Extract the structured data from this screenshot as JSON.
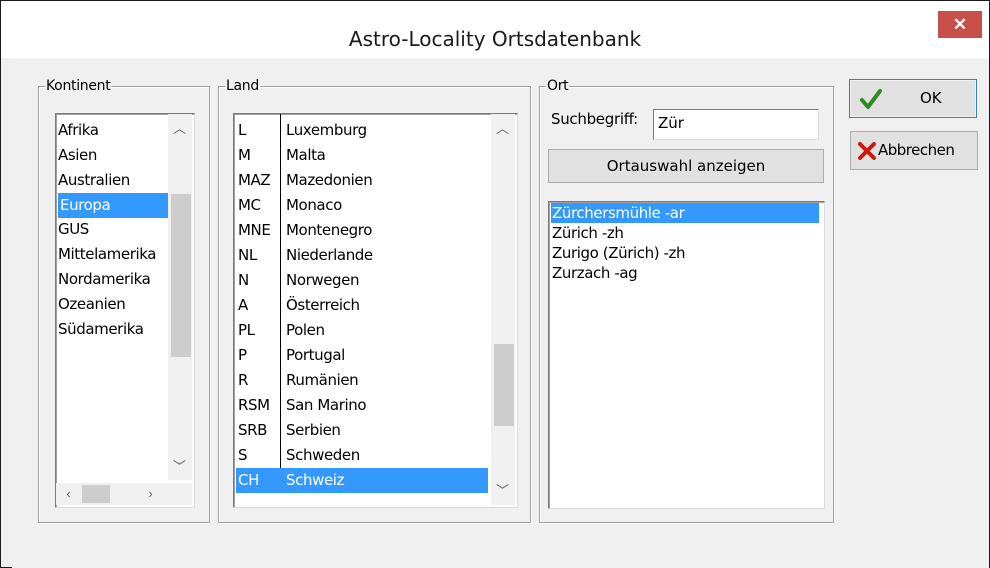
{
  "window": {
    "title": "Astro-Locality Ortsdatenbank",
    "close_glyph": "✕"
  },
  "kontinent": {
    "label": "Kontinent",
    "items": [
      "Afrika",
      "Asien",
      "Australien",
      "Europa",
      "GUS",
      "Mittelamerika",
      "Nordamerika",
      "Ozeanien",
      "Südamerika"
    ],
    "selected": "Europa"
  },
  "land": {
    "label": "Land",
    "items": [
      {
        "code": "L",
        "name": "Luxemburg"
      },
      {
        "code": "M",
        "name": "Malta"
      },
      {
        "code": "MAZ",
        "name": "Mazedonien"
      },
      {
        "code": "MC",
        "name": "Monaco"
      },
      {
        "code": "MNE",
        "name": "Montenegro"
      },
      {
        "code": "NL",
        "name": "Niederlande"
      },
      {
        "code": "N",
        "name": "Norwegen"
      },
      {
        "code": "A",
        "name": "Österreich"
      },
      {
        "code": "PL",
        "name": "Polen"
      },
      {
        "code": "P",
        "name": "Portugal"
      },
      {
        "code": "R",
        "name": "Rumänien"
      },
      {
        "code": "RSM",
        "name": "San Marino"
      },
      {
        "code": "SRB",
        "name": "Serbien"
      },
      {
        "code": "S",
        "name": "Schweden"
      },
      {
        "code": "CH",
        "name": "Schweiz"
      }
    ],
    "selected": "Schweiz"
  },
  "ort": {
    "label": "Ort",
    "search_label": "Suchbegriff:",
    "search_value": "Zür",
    "show_button": "Ortauswahl anzeigen",
    "results": [
      "Zürchersmühle -ar",
      "Zürich -zh",
      "Zurigo (Zürich) -zh",
      "Zurzach -ag"
    ],
    "selected": "Zürchersmühle -ar"
  },
  "buttons": {
    "ok": "OK",
    "cancel": "Abbrechen"
  },
  "colors": {
    "selection": "#3399ff",
    "close": "#c7504b",
    "check": "#2e8b1f",
    "cross": "#cc1a10"
  },
  "icons": {
    "ok": "green-checkmark-icon",
    "cancel": "red-x-icon"
  }
}
